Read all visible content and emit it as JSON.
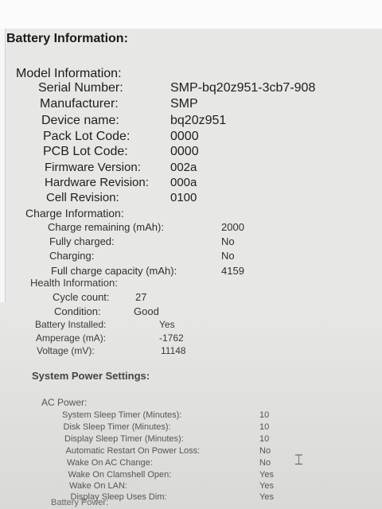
{
  "title": "Battery Information:",
  "model": {
    "heading": "Model Information:",
    "rows": [
      {
        "label": "Serial Number:",
        "value": "SMP-bq20z951-3cb7-908"
      },
      {
        "label": "Manufacturer:",
        "value": "SMP"
      },
      {
        "label": "Device name:",
        "value": "bq20z951"
      },
      {
        "label": "Pack Lot Code:",
        "value": "0000"
      },
      {
        "label": "PCB Lot Code:",
        "value": "0000"
      },
      {
        "label": "Firmware Version:",
        "value": "002a"
      },
      {
        "label": "Hardware Revision:",
        "value": "000a"
      },
      {
        "label": "Cell Revision:",
        "value": "0100"
      }
    ]
  },
  "charge": {
    "heading": "Charge Information:",
    "rows": [
      {
        "label": "Charge remaining (mAh):",
        "value": "2000"
      },
      {
        "label": "Fully charged:",
        "value": "No"
      },
      {
        "label": "Charging:",
        "value": "No"
      },
      {
        "label": "Full charge capacity (mAh):",
        "value": "4159"
      }
    ]
  },
  "health": {
    "heading": "Health Information:",
    "rows": [
      {
        "label": "Cycle count:",
        "value": "27"
      },
      {
        "label": "Condition:",
        "value": "Good"
      }
    ]
  },
  "battery": {
    "rows": [
      {
        "label": "Battery Installed:",
        "value": "Yes"
      },
      {
        "label": "Amperage (mA):",
        "value": "-1762"
      },
      {
        "label": "Voltage (mV):",
        "value": "11148"
      }
    ]
  },
  "power": {
    "heading": "System Power Settings:",
    "ac_heading": "AC Power:",
    "ac_rows": [
      {
        "label": "System Sleep Timer (Minutes):",
        "value": "10"
      },
      {
        "label": "Disk Sleep Timer (Minutes):",
        "value": "10"
      },
      {
        "label": "Display Sleep Timer (Minutes):",
        "value": "10"
      },
      {
        "label": "Automatic Restart On Power Loss:",
        "value": "No"
      },
      {
        "label": "Wake On AC Change:",
        "value": "No"
      },
      {
        "label": "Wake On Clamshell Open:",
        "value": "Yes"
      },
      {
        "label": "Wake On LAN:",
        "value": "Yes"
      },
      {
        "label": "Display Sleep Uses Dim:",
        "value": "Yes"
      }
    ],
    "battery_heading": "Battery Power:"
  }
}
